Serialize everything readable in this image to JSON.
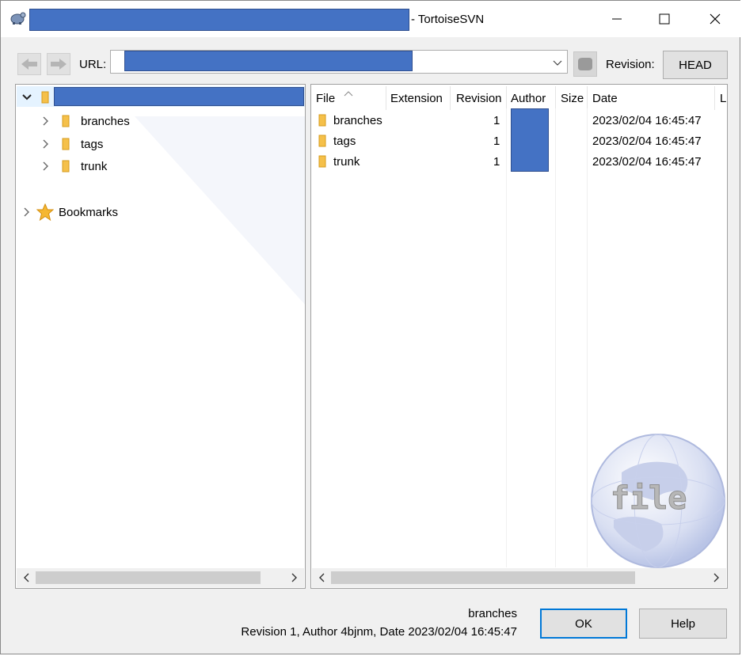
{
  "window": {
    "title_suffix": "- TortoiseSVN",
    "title_prefix_redacted": true
  },
  "toolbar": {
    "url_label": "URL:",
    "revision_label": "Revision:",
    "head_button": "HEAD"
  },
  "tree": {
    "items": [
      {
        "label": "branches"
      },
      {
        "label": "tags"
      },
      {
        "label": "trunk"
      }
    ],
    "bookmarks_label": "Bookmarks"
  },
  "list": {
    "columns": [
      "File",
      "Extension",
      "Revision",
      "Author",
      "Size",
      "Date",
      "L"
    ],
    "rows": [
      {
        "file": "branches",
        "revision": "1",
        "date": "2023/02/04 16:45:47"
      },
      {
        "file": "tags",
        "revision": "1",
        "date": "2023/02/04 16:45:47"
      },
      {
        "file": "trunk",
        "revision": "1",
        "date": "2023/02/04 16:45:47"
      }
    ],
    "watermark_text": "file"
  },
  "footer": {
    "selected_name": "branches",
    "detail": "Revision 1, Author 4bjnm, Date 2023/02/04 16:45:47",
    "ok_label": "OK",
    "help_label": "Help"
  },
  "colors": {
    "redaction": "#4472c4",
    "focus": "#0078d7",
    "folder": "#f5c04a"
  }
}
